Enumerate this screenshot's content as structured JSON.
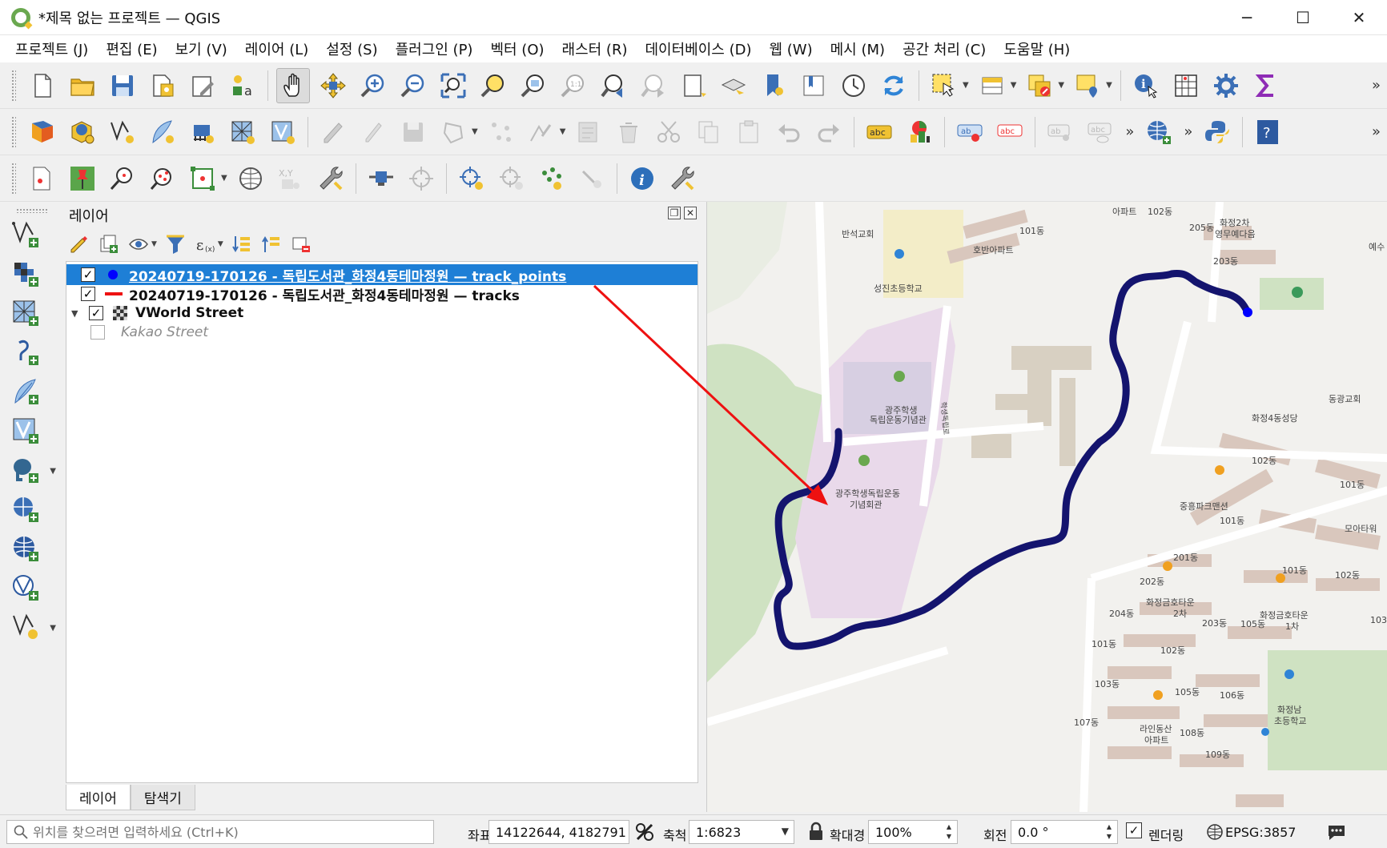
{
  "window": {
    "title": "*제목 없는 프로젝트 — QGIS",
    "minimize": "─",
    "maximize": "☐",
    "close": "✕"
  },
  "menu": [
    "프로젝트 (J)",
    "편집 (E)",
    "보기 (V)",
    "레이어 (L)",
    "설정 (S)",
    "플러그인 (P)",
    "벡터 (O)",
    "래스터 (R)",
    "데이터베이스 (D)",
    "웹 (W)",
    "메시 (M)",
    "공간 처리 (C)",
    "도움말 (H)"
  ],
  "toolbar_more": "»",
  "layers_panel": {
    "title": "레이어",
    "layers": [
      {
        "name": "20240719-170126 - 독립도서관_화정4동테마정원 — track_points",
        "checked": true,
        "symbol": "point",
        "selected": true
      },
      {
        "name": "20240719-170126 - 독립도서관_화정4동테마정원 — tracks",
        "checked": true,
        "symbol": "line",
        "selected": false
      },
      {
        "name": "VWorld Street",
        "checked": true,
        "symbol": "raster",
        "selected": false
      },
      {
        "name": "Kakao Street",
        "checked": false,
        "symbol": "none",
        "selected": false
      }
    ],
    "check_mark": "✓",
    "expand_arrow": "▼",
    "tabs": [
      "레이어",
      "탐색기"
    ]
  },
  "map": {
    "labels": [
      "반석교회",
      "101동",
      "102동",
      "호반아파트",
      "성진초등학교",
      "화정2차",
      "영무예다음",
      "205동",
      "203동",
      "예수",
      "아파트",
      "광주학생",
      "독립운동기념관",
      "광주학생독립운동",
      "기념회관",
      "동광교회",
      "화정4동성당",
      "102동",
      "101동",
      "중흥파크맨션",
      "101동",
      "모아타워",
      "201동",
      "101동",
      "102동",
      "202동",
      "화정금호타운",
      "2차",
      "204동",
      "화정금호타운",
      "1차",
      "203동",
      "105동",
      "103",
      "101동",
      "102동",
      "103동",
      "105동",
      "106동",
      "107동",
      "라인동산",
      "아파트",
      "108동",
      "109동",
      "화정남",
      "초등학교",
      "학생독립로"
    ],
    "track_color": "#14146e",
    "point_color": "#0000ff",
    "arrow_color": "#ee1111"
  },
  "status": {
    "locator_placeholder": "위치를 찾으려면 입력하세요 (Ctrl+K)",
    "coord_label": "좌표",
    "coord_value": "14122644, 4182791",
    "scale_label": "축척",
    "scale_value": "1:6823",
    "magnifier_label": "확대경",
    "magnifier_value": "100%",
    "rotation_label": "회전",
    "rotation_value": "0.0 °",
    "render_label": "렌더링",
    "render_checked": "✓",
    "crs": "EPSG:3857"
  }
}
